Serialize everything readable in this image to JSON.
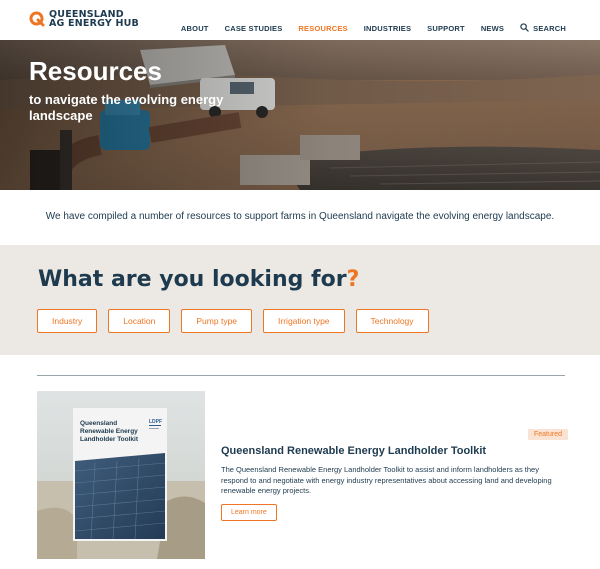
{
  "brand": {
    "line1": "QUEENSLAND",
    "line2": "AG ENERGY HUB",
    "accent": "#ee7623",
    "navy": "#1d3a4f"
  },
  "nav": {
    "items": [
      {
        "label": "ABOUT",
        "active": false
      },
      {
        "label": "CASE STUDIES",
        "active": false
      },
      {
        "label": "RESOURCES",
        "active": true
      },
      {
        "label": "INDUSTRIES",
        "active": false
      },
      {
        "label": "SUPPORT",
        "active": false
      },
      {
        "label": "NEWS",
        "active": false
      }
    ],
    "search_label": "SEARCH",
    "search_icon": "search-icon"
  },
  "hero": {
    "title": "Resources",
    "subtitle": "to navigate the evolving energy landscape"
  },
  "intro": "We have compiled a number of resources to support farms in Queensland navigate the evolving energy landscape.",
  "filters": {
    "heading": "What are you looking for",
    "heading_mark": "?",
    "chips": [
      "Industry",
      "Location",
      "Pump type",
      "Irrigation type",
      "Technology"
    ]
  },
  "resource": {
    "badge": "Featured",
    "title": "Queensland Renewable Energy Landholder Toolkit",
    "description": "The Queensland Renewable Energy Landholder Toolkit to assist and inform landholders as they respond to and negotiate with energy industry representatives about accessing land and developing renewable energy projects.",
    "cta": "Learn more",
    "thumb": {
      "title_l1": "Queensland",
      "title_l2": "Renewable Energy",
      "title_l3": "Landholder Toolkit",
      "logo_text": "LDPF"
    }
  }
}
